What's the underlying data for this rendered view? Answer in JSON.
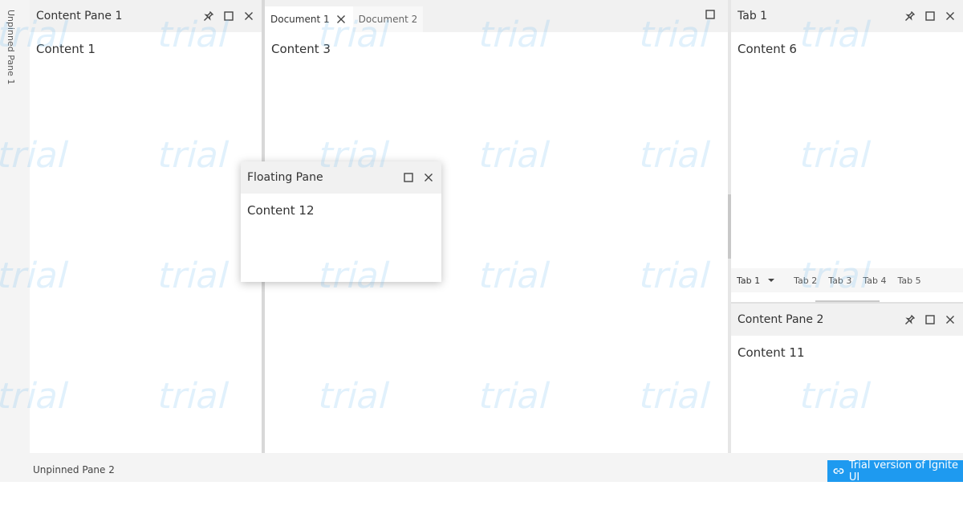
{
  "unpinned": {
    "left_label": "Unpinned Pane 1",
    "bottom_label": "Unpinned Pane 2"
  },
  "pane1": {
    "title": "Content Pane 1",
    "content": "Content 1",
    "icons": [
      "pin-icon",
      "maximize-icon",
      "close-icon"
    ]
  },
  "documents": {
    "tabs": [
      {
        "label": "Document 1",
        "active": true
      },
      {
        "label": "Document 2",
        "active": false
      }
    ],
    "content": "Content 3"
  },
  "tabgroup": {
    "title": "Tab 1",
    "content": "Content 6",
    "tabs": [
      "Tab 1",
      "Tab 2",
      "Tab 3",
      "Tab 4",
      "Tab 5"
    ]
  },
  "pane2": {
    "title": "Content Pane 2",
    "content": "Content 11"
  },
  "floating": {
    "title": "Floating Pane",
    "content": "Content 12"
  },
  "trial_badge": {
    "label": "Trial version of Ignite UI",
    "color": "#1e9af0"
  },
  "watermark": {
    "text": "trial"
  }
}
